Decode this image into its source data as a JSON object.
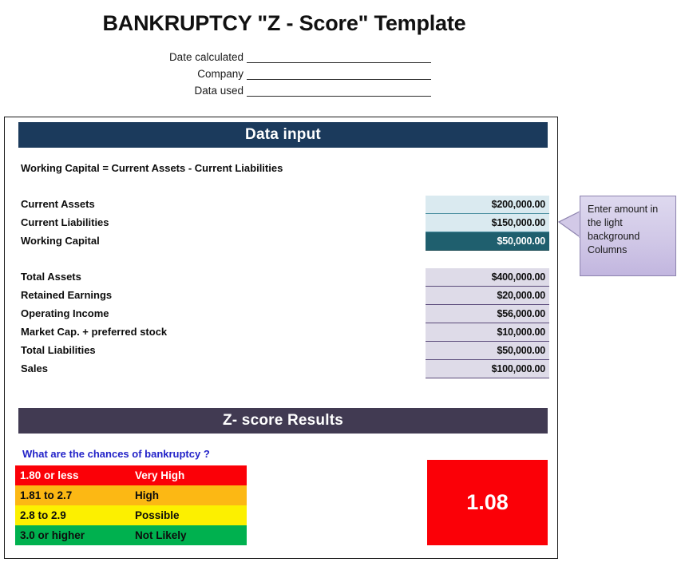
{
  "page_title": "BANKRUPTCY \"Z - Score\" Template",
  "header_form": {
    "rows": [
      {
        "label": "Date calculated",
        "value": ""
      },
      {
        "label": "Company",
        "value": ""
      },
      {
        "label": "Data used",
        "value": ""
      }
    ]
  },
  "data_input": {
    "bar_title": "Data input",
    "bar_color": "#1b3a5c",
    "formula": "Working Capital  = Current Assets - Current Liabilities",
    "working_capital_rows": [
      {
        "label": "Current Assets",
        "value": "$200,000.00",
        "style": "cyan"
      },
      {
        "label": "Current Liabilities",
        "value": "$150,000.00",
        "style": "cyan"
      },
      {
        "label": "Working Capital",
        "value": "$50,000.00",
        "style": "teal"
      }
    ],
    "totals_rows": [
      {
        "label": "Total Assets",
        "value": "$400,000.00",
        "style": "lavender"
      },
      {
        "label": "Retained Earnings",
        "value": "$20,000.00",
        "style": "lavender"
      },
      {
        "label": "Operating Income",
        "value": "$56,000.00",
        "style": "lavender"
      },
      {
        "label": "Market Cap. + preferred stock",
        "value": "$10,000.00",
        "style": "lavender"
      },
      {
        "label": "Total Liabilities",
        "value": "$50,000.00",
        "style": "lavender"
      },
      {
        "label": "Sales",
        "value": "$100,000.00",
        "style": "lavender"
      }
    ]
  },
  "callout": {
    "text": "Enter amount in the light background Columns",
    "fill_color": "#cfc6e6",
    "border_color": "#8d83ae"
  },
  "z_results": {
    "bar_title": "Z- score Results",
    "bar_color": "#413a52",
    "chances_question": "What are the chances of bankruptcy ?",
    "chances_question_color": "#2222c8",
    "legend": [
      {
        "range": "1.80 or less",
        "likelihood": "Very High",
        "bg": "#fb0007",
        "fg": "#ffffff"
      },
      {
        "range": "1.81 to  2.7",
        "likelihood": "High",
        "bg": "#fcb814",
        "fg": "#0d0d0d"
      },
      {
        "range": "2.8 to 2.9",
        "likelihood": "Possible",
        "bg": "#fcf000",
        "fg": "#0d0d0d"
      },
      {
        "range": "3.0 or higher",
        "likelihood": "Not Likely",
        "bg": "#00b14f",
        "fg": "#0d0d0d"
      }
    ],
    "score_value": "1.08",
    "score_bg": "#fb0007",
    "score_fg": "#ffffff"
  }
}
